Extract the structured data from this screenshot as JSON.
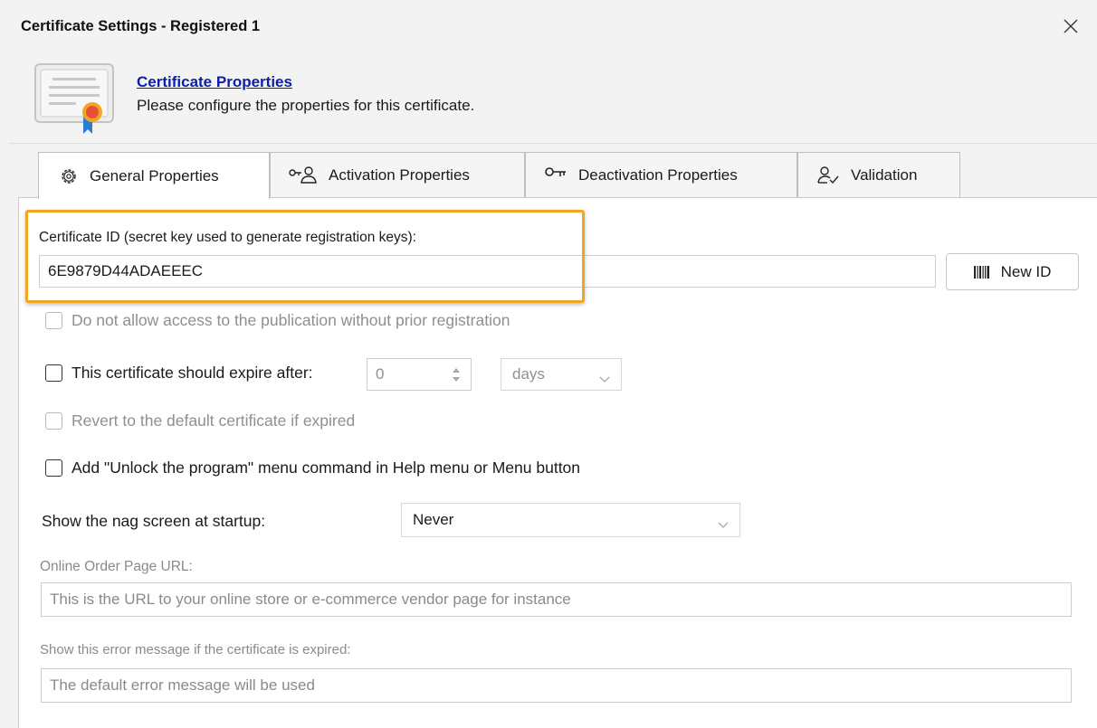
{
  "dialog": {
    "title": "Certificate Settings - Registered 1",
    "header_link": "Certificate Properties",
    "header_desc": "Please configure the properties for this certificate."
  },
  "tabs": [
    {
      "label": "General Properties",
      "icon": "gear-icon",
      "active": true
    },
    {
      "label": "Activation Properties",
      "icon": "key-user-icon",
      "active": false
    },
    {
      "label": "Deactivation Properties",
      "icon": "key-icon",
      "active": false
    },
    {
      "label": "Validation",
      "icon": "user-check-icon",
      "active": false
    }
  ],
  "general": {
    "cert_id_label": "Certificate ID (secret key used to generate registration keys):",
    "cert_id_value": "6E9879D44ADAEEEC",
    "new_id_button": "New ID",
    "no_access_label": "Do not allow access to the publication without prior registration",
    "expire_label": "This certificate should expire after:",
    "expire_value": "0",
    "expire_unit": "days",
    "revert_label": "Revert to the default certificate if expired",
    "unlock_label": "Add \"Unlock the program\" menu command in Help menu or Menu button",
    "nag_label": "Show the nag screen at startup:",
    "nag_value": "Never",
    "order_url_label": "Online Order Page URL:",
    "order_url_placeholder": "This is the URL to your online store or e-commerce vendor page for instance",
    "error_msg_label": "Show this error message if the certificate is expired:",
    "error_msg_placeholder": "The default error message will be used"
  },
  "colors": {
    "highlight": "#f0a623",
    "link": "#0b1fa8"
  }
}
